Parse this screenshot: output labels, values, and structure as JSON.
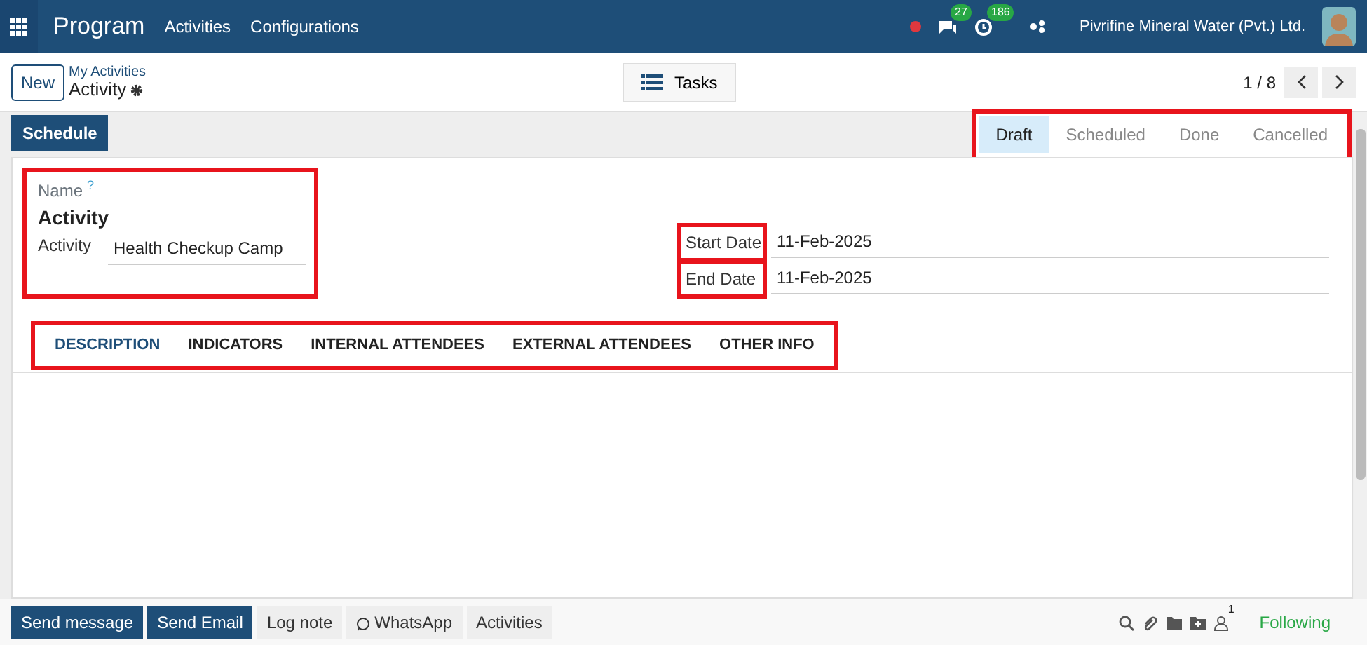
{
  "navbar": {
    "app_name": "Program",
    "menu": [
      "Activities",
      "Configurations"
    ],
    "messages_count": "27",
    "activities_count": "186",
    "company": "Pivrifine Mineral Water (Pvt.) Ltd."
  },
  "control_panel": {
    "new_button": "New",
    "breadcrumb": "My Activities",
    "record_title": "Activity",
    "view_button": "Tasks",
    "pager": "1 / 8"
  },
  "statusbar": {
    "action_button": "Schedule",
    "highlighted": true,
    "stages": [
      {
        "label": "Draft",
        "selected": true
      },
      {
        "label": "Scheduled",
        "selected": false
      },
      {
        "label": "Done",
        "selected": false
      },
      {
        "label": "Cancelled",
        "selected": false
      }
    ]
  },
  "form": {
    "name_label": "Name",
    "help_mark": "?",
    "name_value": "Activity",
    "name_highlighted": true,
    "activity_label": "Activity",
    "activity_value": "Health Checkup Camp",
    "dates": [
      {
        "label": "Start Date",
        "value": "11-Feb-2025",
        "highlighted": true
      },
      {
        "label": "End Date",
        "value": "11-Feb-2025",
        "highlighted": true
      }
    ],
    "tabs_highlighted": true,
    "tabs": [
      {
        "label": "DESCRIPTION",
        "selected": true
      },
      {
        "label": "INDICATORS",
        "selected": false
      },
      {
        "label": "INTERNAL ATTENDEES",
        "selected": false
      },
      {
        "label": "EXTERNAL ATTENDEES",
        "selected": false
      },
      {
        "label": "OTHER INFO",
        "selected": false
      }
    ]
  },
  "chatter": {
    "buttons": [
      {
        "label": "Send message",
        "kind": "primary"
      },
      {
        "label": "Send Email",
        "kind": "primary"
      },
      {
        "label": "Log note",
        "kind": "light"
      },
      {
        "label": "WhatsApp",
        "kind": "whatsapp"
      },
      {
        "label": "Activities",
        "kind": "light"
      }
    ],
    "followers_count": "1",
    "follow_state": "Following"
  }
}
